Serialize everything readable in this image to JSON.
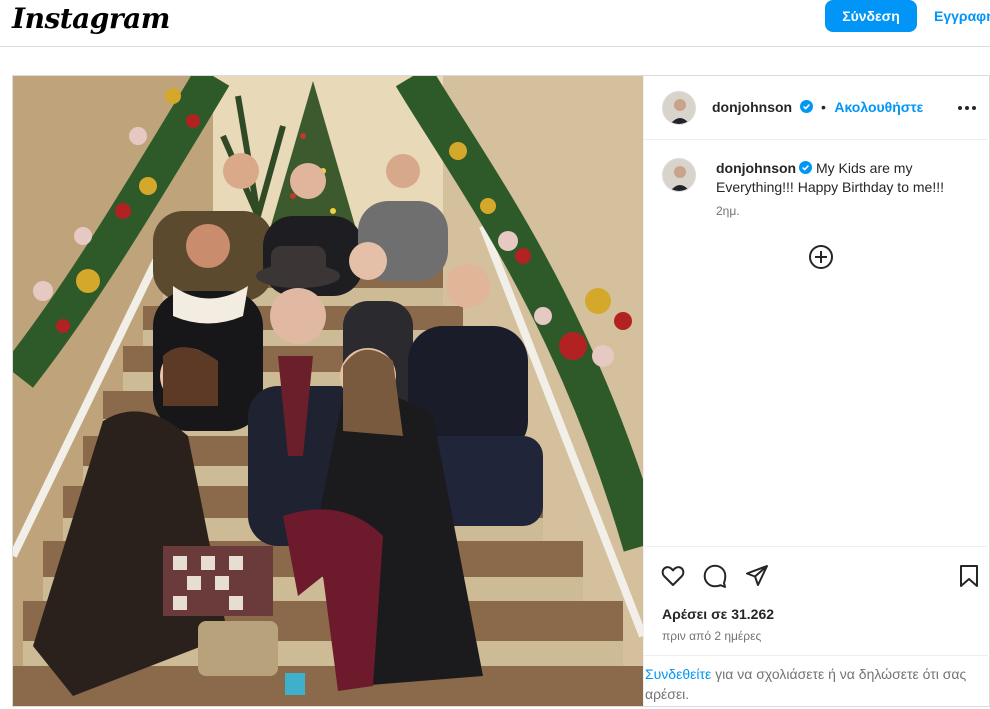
{
  "topbar": {
    "logo_text": "Instagram",
    "login_label": "Σύνδεση",
    "signup_label": "Εγγραφή"
  },
  "post": {
    "author": {
      "username": "donjohnson",
      "verified": true,
      "follow_label": "Ακολουθήστε"
    },
    "caption": {
      "username": "donjohnson",
      "text": "My Kids are my Everything!!! Happy Birthday to me!!!",
      "time_ago": "2ημ."
    },
    "more_icon": "more-horizontal-icon",
    "load_more_icon": "plus-circle-icon",
    "actions": {
      "like_icon": "heart-icon",
      "comment_icon": "comment-icon",
      "share_icon": "send-icon",
      "save_icon": "bookmark-icon"
    },
    "likes_text": "Αρέσει σε 31.262",
    "date_text": "πριν από 2 ημέρες",
    "login_prompt": {
      "link_text": "Συνδεθείτε",
      "rest_text": " για να σχολιάσετε ή να δηλώσετε ότι σας αρέσει."
    }
  },
  "colors": {
    "accent": "#0095f6",
    "text_primary": "#262626",
    "text_secondary": "#737373",
    "border": "#dbdbdb"
  }
}
